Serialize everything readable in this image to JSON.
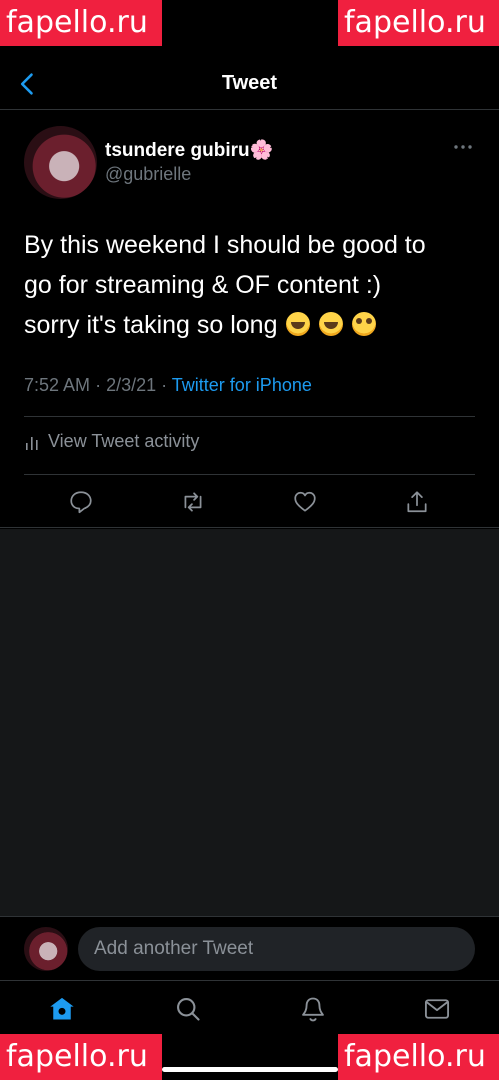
{
  "watermark": "fapello.ru",
  "header": {
    "title": "Tweet"
  },
  "tweet": {
    "display_name": "tsundere gubiru🌸",
    "username": "@gubrielle",
    "text_line1": "By this weekend I should be good to",
    "text_line2": "go for streaming & OF content :)",
    "text_line3": "sorry it's taking so long",
    "emojis": [
      "loudly-crying-face",
      "loudly-crying-face",
      "pleading-face"
    ],
    "time": "7:52 AM",
    "date": "2/3/21",
    "source": "Twitter for iPhone",
    "activity_label": "View Tweet activity"
  },
  "reply": {
    "placeholder": "Add another Tweet"
  },
  "tabs": [
    "home-icon",
    "search-icon",
    "notifications-icon",
    "messages-icon"
  ],
  "colors": {
    "accent": "#1d9bf0",
    "background": "#000000",
    "muted": "#6e767d",
    "watermark": "#f0203f"
  }
}
